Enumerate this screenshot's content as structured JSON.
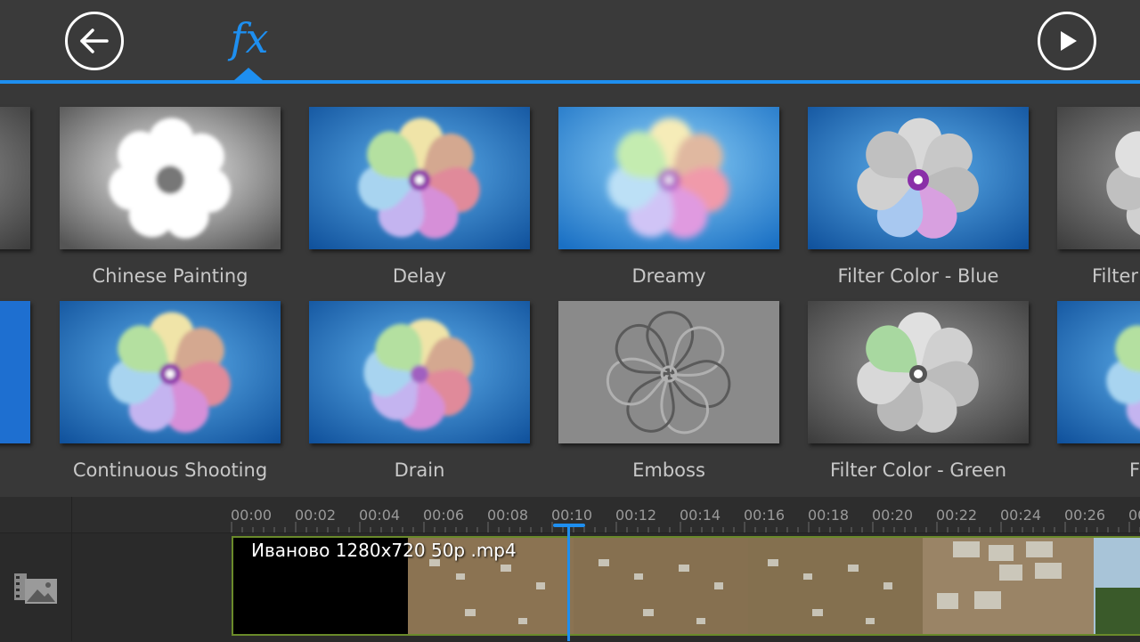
{
  "toolbar": {
    "back_icon": "arrow-left-icon",
    "fx_label": "fx",
    "play_icon": "play-icon",
    "accent_color": "#1e8ff0"
  },
  "effects": {
    "row1": [
      {
        "label": "Chinese Painting"
      },
      {
        "label": "Delay"
      },
      {
        "label": "Dreamy"
      },
      {
        "label": "Filter Color - Blue"
      },
      {
        "label": "Filter"
      }
    ],
    "row2": [
      {
        "label": "Continuous Shooting"
      },
      {
        "label": "Drain"
      },
      {
        "label": "Emboss"
      },
      {
        "label": "Filter Color - Green"
      },
      {
        "label": "F"
      }
    ]
  },
  "timeline": {
    "ticks": [
      "00:00",
      "00:02",
      "00:04",
      "00:06",
      "00:08",
      "00:10",
      "00:12",
      "00:14",
      "00:16",
      "00:18",
      "00:20",
      "00:22",
      "00:24",
      "00:26",
      "00"
    ],
    "clip_name": "Иваново 1280x720 50p .mp4",
    "media_icon": "film-image-icon"
  }
}
